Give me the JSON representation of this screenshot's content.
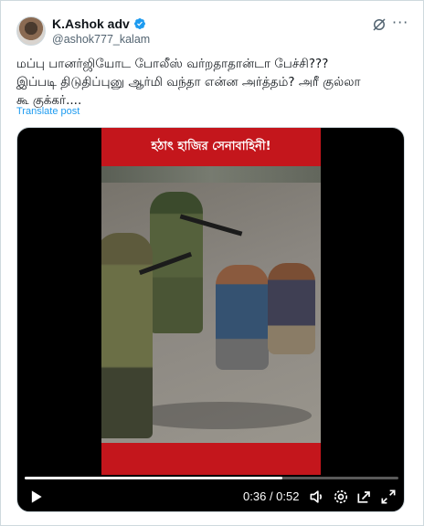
{
  "author": {
    "display_name": "K.Ashok adv",
    "handle": "@ashok777_kalam",
    "verified": true,
    "verified_color": "#1d9bf0"
  },
  "header_icons": [
    "grok-icon",
    "more-icon"
  ],
  "post": {
    "lines": [
      "மப்பு பானர்ஜியோட போலீஸ் வர்றதாதான்டா பேச்சி???",
      "இப்படி திடுதிப்புனு ஆர்மி வந்தா என்ன அர்த்தம்? அரீ குல்லா",
      "கூ குக்கர்...."
    ],
    "translate_label": "Translate post",
    "link_color": "#1d9bf0"
  },
  "video": {
    "banner_text": "হঠাৎ হাজির সেনাবাহিনী!",
    "banner_color": "#c4161c",
    "current_time": "0:36",
    "duration": "0:52",
    "progress": 0.69,
    "controls": [
      "play-icon",
      "volume-icon",
      "settings-icon",
      "pip-icon",
      "fullscreen-icon"
    ]
  }
}
